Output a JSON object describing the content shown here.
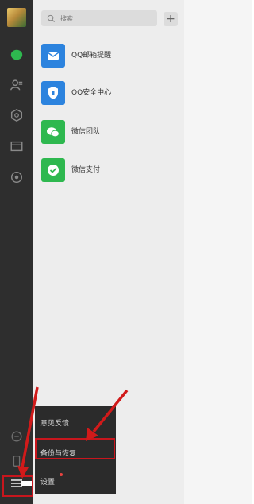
{
  "search": {
    "placeholder": "搜索"
  },
  "add_button": {
    "label": "+"
  },
  "contacts": [
    {
      "label": "QQ邮箱提醒",
      "icon": "mail-icon",
      "color": "#2c83de"
    },
    {
      "label": "QQ安全中心",
      "icon": "shield-icon",
      "color": "#2c83de"
    },
    {
      "label": "微信团队",
      "icon": "wechat-icon",
      "color": "#2eb84f"
    },
    {
      "label": "微信支付",
      "icon": "wechat-pay-icon",
      "color": "#2eb84f"
    }
  ],
  "popup_menu": {
    "items": [
      {
        "label": "意见反馈"
      },
      {
        "label": "备份与恢复"
      },
      {
        "label": "设置"
      }
    ]
  },
  "colors": {
    "sidebar": "#2e2e2e",
    "panel": "#ededed",
    "highlight": "#c8161d",
    "accent_green": "#2eb84f"
  }
}
